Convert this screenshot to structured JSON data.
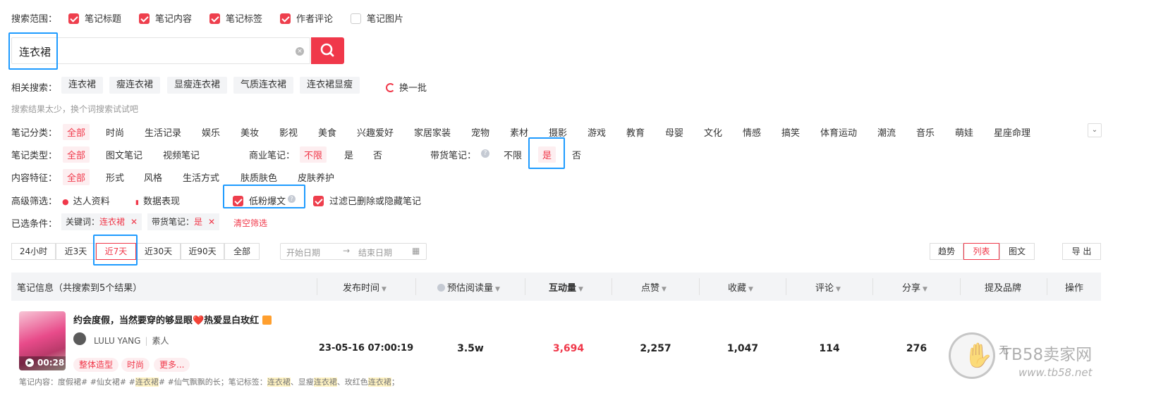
{
  "scope": {
    "label": "搜索范围：",
    "options": [
      {
        "label": "笔记标题",
        "checked": true
      },
      {
        "label": "笔记内容",
        "checked": true
      },
      {
        "label": "笔记标签",
        "checked": true
      },
      {
        "label": "作者评论",
        "checked": true
      },
      {
        "label": "笔记图片",
        "checked": false
      }
    ]
  },
  "search": {
    "value": "连衣裙",
    "clear_icon": "close-circle-icon",
    "button_icon": "search-icon"
  },
  "related": {
    "label": "相关搜索：",
    "items": [
      "连衣裙",
      "瘦连衣裙",
      "显瘦连衣裙",
      "气质连衣裙",
      "连衣裙显瘦"
    ],
    "refresh": "换一批"
  },
  "hint": "搜索结果太少，换个词搜索试试吧",
  "category": {
    "label": "笔记分类：",
    "items": [
      "全部",
      "时尚",
      "生活记录",
      "娱乐",
      "美妆",
      "影视",
      "美食",
      "兴趣爱好",
      "家居家装",
      "宠物",
      "素材",
      "摄影",
      "游戏",
      "教育",
      "母婴",
      "文化",
      "情感",
      "搞笑",
      "体育运动",
      "潮流",
      "音乐",
      "萌娃",
      "星座命理"
    ]
  },
  "type_row": {
    "label": "笔记类型：",
    "items": [
      "全部",
      "图文笔记",
      "视频笔记"
    ],
    "commercial_label": "商业笔记：",
    "commercial": [
      "不限",
      "是",
      "否"
    ],
    "goods_label": "带货笔记：",
    "goods": [
      "不限",
      "是",
      "否"
    ]
  },
  "feature": {
    "label": "内容特征：",
    "items": [
      "全部",
      "形式",
      "风格",
      "生活方式",
      "肤质肤色",
      "皮肤养护"
    ]
  },
  "advanced": {
    "label": "高级筛选：",
    "talent": "达人资料",
    "data": "数据表现",
    "low_fans": "低粉爆文",
    "filter_deleted": "过滤已删除或隐藏笔记"
  },
  "selected": {
    "label": "已选条件：",
    "kw_label": "关键词：",
    "kw_value": "连衣裙",
    "goods_label": "带货笔记：",
    "goods_value": "是",
    "clear": "清空筛选"
  },
  "time": {
    "options": [
      "24小时",
      "近3天",
      "近7天",
      "近30天",
      "近90天",
      "全部"
    ],
    "start_placeholder": "开始日期",
    "end_placeholder": "结束日期"
  },
  "views": {
    "items": [
      "趋势",
      "列表",
      "图文"
    ],
    "export": "导 出"
  },
  "table": {
    "headers": [
      "笔记信息（共搜索到5个结果）",
      "发布时间",
      "预估阅读量",
      "互动量",
      "点赞",
      "收藏",
      "评论",
      "分享",
      "提及品牌",
      "操作"
    ],
    "row": {
      "title": "约会度假，当然要穿的够显眼❤️热爱显白玫红",
      "author": "LULU YANG",
      "author_tag": "素人",
      "duration": "00:28",
      "tags": [
        "整体造型",
        "时尚",
        "更多..."
      ],
      "time": "23-05-16 07:00:19",
      "reads": "3.5w",
      "interactions": "3,694",
      "likes": "2,257",
      "collects": "1,047",
      "comments": "114",
      "shares": "276",
      "brand": "无",
      "content_label": "笔记内容：",
      "content_a": "度假裙# #仙女裙# #",
      "content_kw1": "连衣裙",
      "content_b": "# #仙气飘飘的长；笔记标签：",
      "content_kw2": "连衣裙",
      "content_c": "、显瘦",
      "content_kw3": "连衣裙",
      "content_d": "、玫红色",
      "content_kw4": "连衣裙",
      "content_e": "；"
    }
  },
  "watermark": {
    "text": "TB58卖家网",
    "url": "www.tb58.net"
  },
  "colors": {
    "accent": "#f0384a",
    "highlight": "#1e9bff"
  }
}
